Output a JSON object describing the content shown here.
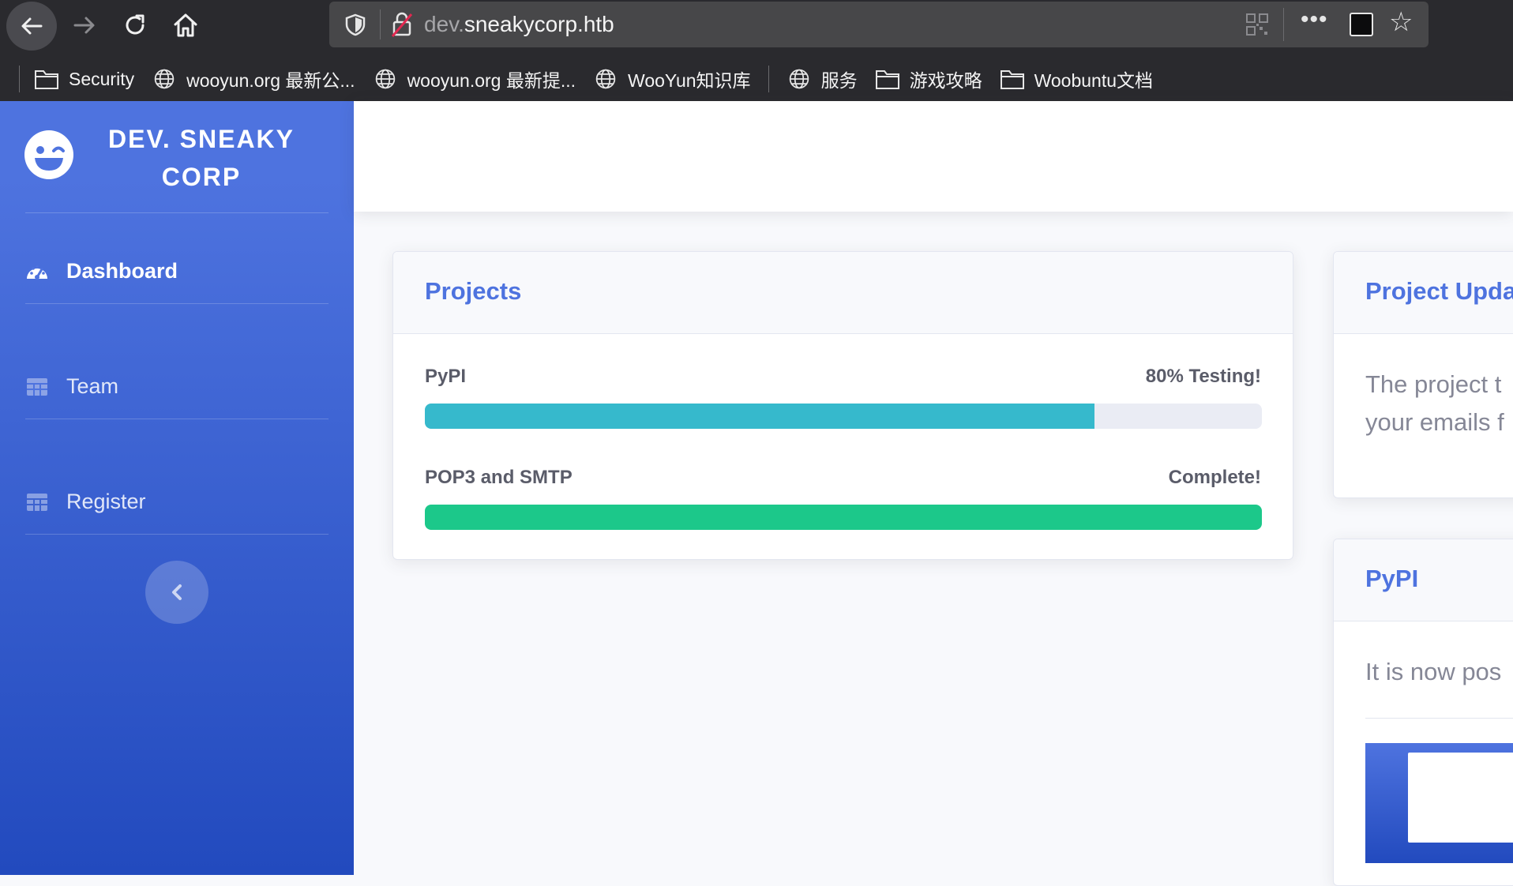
{
  "browser": {
    "url_prefix": "dev.",
    "url_host": "sneakycorp.htb",
    "bookmarks": [
      {
        "label": "Security",
        "icon": "folder-icon"
      },
      {
        "label": "wooyun.org 最新公...",
        "icon": "globe-icon"
      },
      {
        "label": "wooyun.org 最新提...",
        "icon": "globe-icon"
      },
      {
        "label": "WooYun知识库",
        "icon": "globe-icon"
      },
      {
        "label": "服务",
        "icon": "globe-icon"
      },
      {
        "label": "游戏攻略",
        "icon": "folder-icon"
      },
      {
        "label": "Woobuntu文档",
        "icon": "folder-icon"
      }
    ]
  },
  "sidebar": {
    "brand_line1": "DEV. SNEAKY",
    "brand_line2": "CORP",
    "items": [
      {
        "label": "Dashboard",
        "icon": "tachometer-icon",
        "active": true
      },
      {
        "label": "Team",
        "icon": "table-icon",
        "active": false
      },
      {
        "label": "Register",
        "icon": "table-icon",
        "active": false
      }
    ],
    "toggle_icon": "chevron-left-icon"
  },
  "projects_card": {
    "title": "Projects",
    "projects": [
      {
        "name": "PyPI",
        "status": "80% Testing!",
        "progress": 0.8,
        "color": "#36b9cc"
      },
      {
        "name": "POP3 and SMTP",
        "status": "Complete!",
        "progress": 1.0,
        "color": "#1cc88a"
      }
    ]
  },
  "updates_card": {
    "title": "Project Upda",
    "line1": "The project t",
    "line2": "your emails f"
  },
  "pypi_card": {
    "title": "PyPI",
    "line1": "It is now pos"
  },
  "colors": {
    "primary": "#4e73df",
    "info": "#36b9cc",
    "success": "#1cc88a"
  }
}
